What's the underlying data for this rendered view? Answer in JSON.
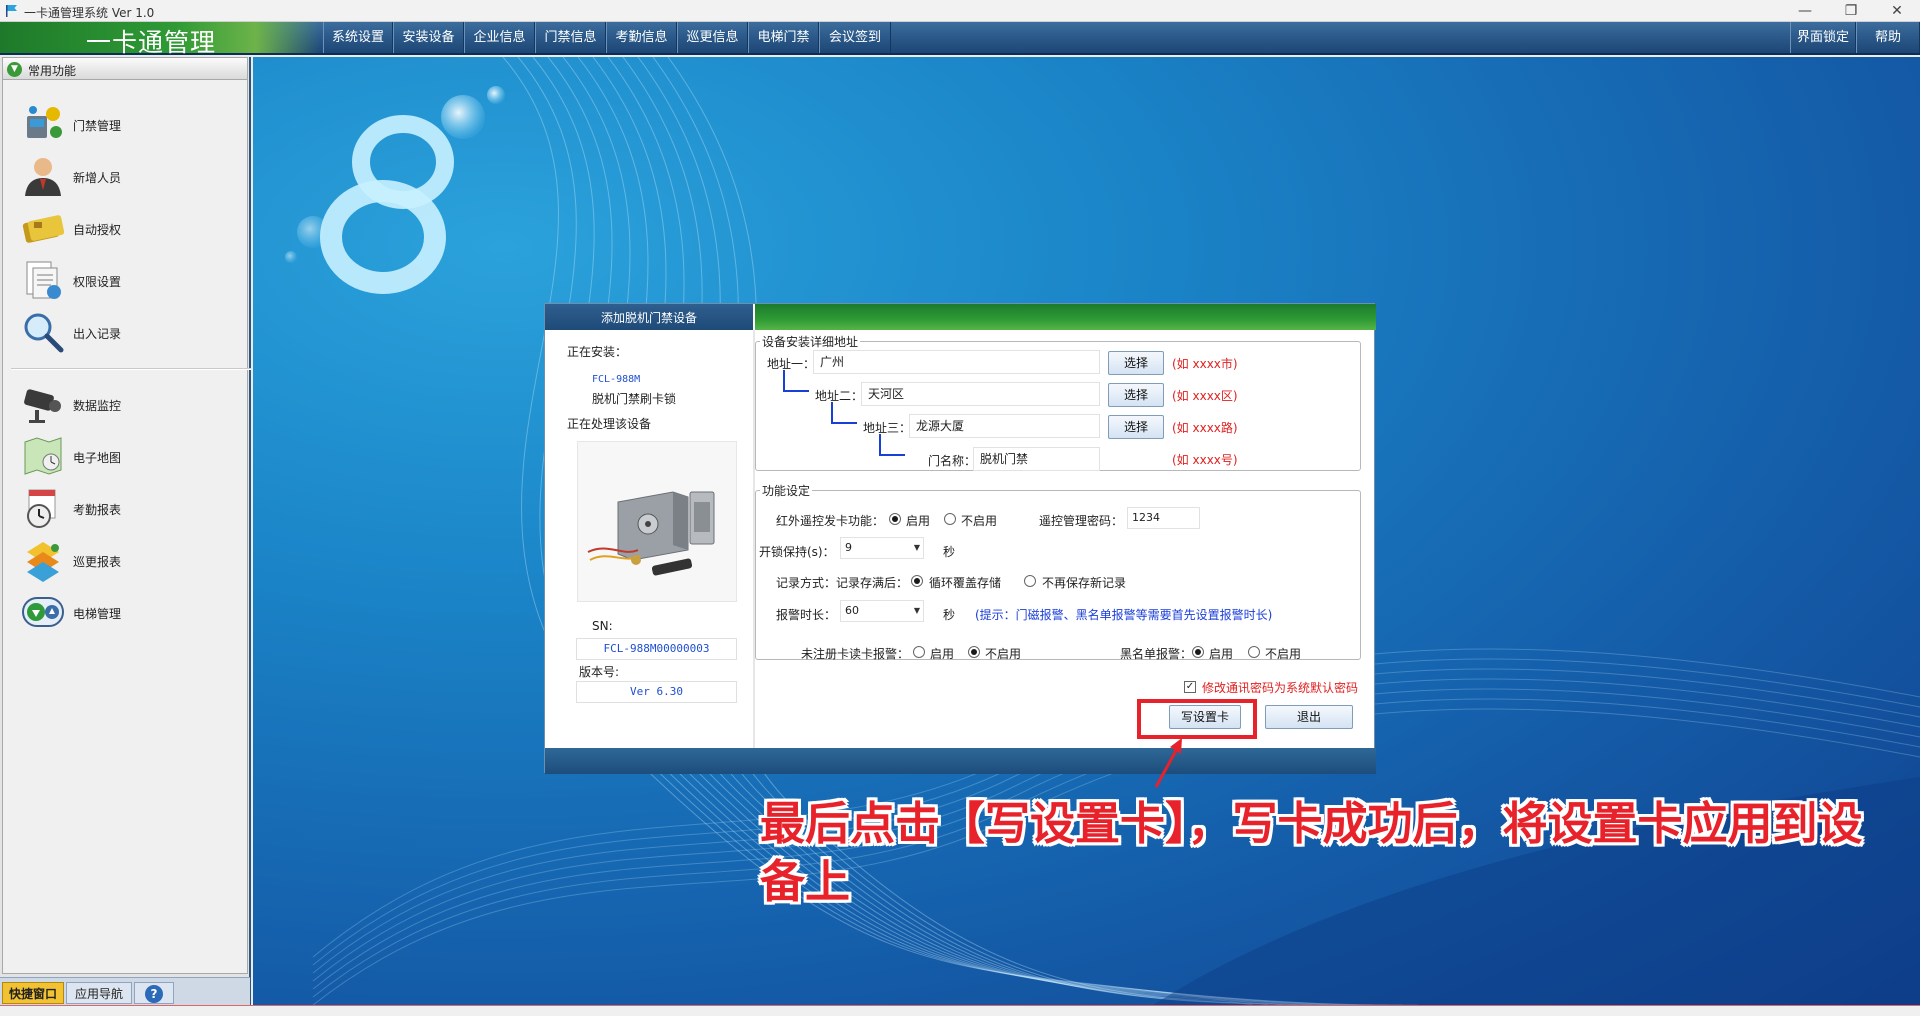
{
  "window": {
    "title": "一卡通管理系统 Ver 1.0",
    "minimize": "—",
    "maximize": "❐",
    "close": "✕"
  },
  "menubar": {
    "brand": "一卡通管理",
    "items": [
      "系统设置",
      "安装设备",
      "企业信息",
      "门禁信息",
      "考勤信息",
      "巡更信息",
      "电梯门禁",
      "会议签到"
    ],
    "right_items": [
      "界面锁定",
      "帮助"
    ]
  },
  "sidebar": {
    "header": "常用功能",
    "group1": [
      {
        "label": "门禁管理",
        "icon": "door-control-icon"
      },
      {
        "label": "新增人员",
        "icon": "person-icon"
      },
      {
        "label": "自动授权",
        "icon": "card-icon"
      },
      {
        "label": "权限设置",
        "icon": "permission-icon"
      },
      {
        "label": "出入记录",
        "icon": "magnifier-icon"
      }
    ],
    "group2": [
      {
        "label": "数据监控",
        "icon": "camera-icon"
      },
      {
        "label": "电子地图",
        "icon": "map-icon"
      },
      {
        "label": "考勤报表",
        "icon": "clock-report-icon"
      },
      {
        "label": "巡更报表",
        "icon": "patrol-report-icon"
      },
      {
        "label": "电梯管理",
        "icon": "elevator-icon"
      }
    ],
    "tabs": [
      "快捷窗口",
      "应用导航",
      "?"
    ]
  },
  "dialog": {
    "title": "添加脱机门禁设备",
    "installing_label": "正在安装：",
    "model": "FCL-988M",
    "device_name": "脱机门禁刷卡锁",
    "processing_label": "正在处理该设备",
    "sn_label": "SN:",
    "sn_value": "FCL-988M00000003",
    "version_label": "版本号:",
    "version_value": "Ver 6.30",
    "address": {
      "legend": "设备安装详细地址",
      "rows": [
        {
          "label": "地址一：",
          "value": "广州",
          "button": "选择",
          "hint": "(如 xxxx市)"
        },
        {
          "label": "地址二：",
          "value": "天河区",
          "button": "选择",
          "hint": "(如 xxxx区)"
        },
        {
          "label": "地址三：",
          "value": "龙源大厦",
          "button": "选择",
          "hint": "(如 xxxx路)"
        },
        {
          "label": "门名称：",
          "value": "脱机门禁",
          "hint": "(如 xxxx号)"
        }
      ]
    },
    "function": {
      "legend": "功能设定",
      "ir_label": "红外遥控发卡功能：",
      "enable": "启用",
      "disable": "不启用",
      "remote_pwd_label": "遥控管理密码：",
      "remote_pwd_value": "1234",
      "unlock_label": "开锁保持(s)：",
      "unlock_value": "9",
      "seconds": "秒",
      "record_label": "记录方式：",
      "record_full_label": "记录存满后：",
      "record_opt1": "循环覆盖存储",
      "record_opt2": "不再保存新记录",
      "alarm_label": "报警时长：",
      "alarm_value": "60",
      "alarm_tip": "(提示：门磁报警、黑名单报警等需要首先设置报警时长)",
      "unreg_label": "未注册卡读卡报警：",
      "blacklist_label": "黑名单报警："
    },
    "checkbox_label": "修改通讯密码为系统默认密码",
    "write_button": "写设置卡",
    "exit_button": "退出"
  },
  "annotation": {
    "text": "最后点击【写设置卡】，写卡成功后，将设置卡应用到设备上"
  },
  "colors": {
    "accent_red": "#e8222a",
    "hint_red": "#e02020",
    "tip_blue": "#1a3ed8",
    "menubar_blue": "#2c5b8b",
    "brand_green": "#2f9a35"
  }
}
